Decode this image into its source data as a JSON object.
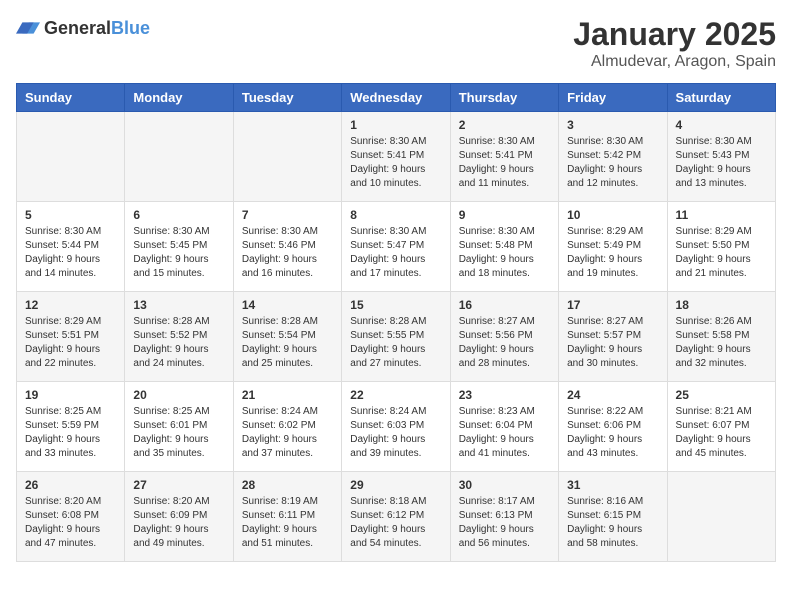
{
  "header": {
    "logo_general": "General",
    "logo_blue": "Blue",
    "month": "January 2025",
    "location": "Almudevar, Aragon, Spain"
  },
  "weekdays": [
    "Sunday",
    "Monday",
    "Tuesday",
    "Wednesday",
    "Thursday",
    "Friday",
    "Saturday"
  ],
  "weeks": [
    [
      {
        "day": "",
        "info": ""
      },
      {
        "day": "",
        "info": ""
      },
      {
        "day": "",
        "info": ""
      },
      {
        "day": "1",
        "info": "Sunrise: 8:30 AM\nSunset: 5:41 PM\nDaylight: 9 hours\nand 10 minutes."
      },
      {
        "day": "2",
        "info": "Sunrise: 8:30 AM\nSunset: 5:41 PM\nDaylight: 9 hours\nand 11 minutes."
      },
      {
        "day": "3",
        "info": "Sunrise: 8:30 AM\nSunset: 5:42 PM\nDaylight: 9 hours\nand 12 minutes."
      },
      {
        "day": "4",
        "info": "Sunrise: 8:30 AM\nSunset: 5:43 PM\nDaylight: 9 hours\nand 13 minutes."
      }
    ],
    [
      {
        "day": "5",
        "info": "Sunrise: 8:30 AM\nSunset: 5:44 PM\nDaylight: 9 hours\nand 14 minutes."
      },
      {
        "day": "6",
        "info": "Sunrise: 8:30 AM\nSunset: 5:45 PM\nDaylight: 9 hours\nand 15 minutes."
      },
      {
        "day": "7",
        "info": "Sunrise: 8:30 AM\nSunset: 5:46 PM\nDaylight: 9 hours\nand 16 minutes."
      },
      {
        "day": "8",
        "info": "Sunrise: 8:30 AM\nSunset: 5:47 PM\nDaylight: 9 hours\nand 17 minutes."
      },
      {
        "day": "9",
        "info": "Sunrise: 8:30 AM\nSunset: 5:48 PM\nDaylight: 9 hours\nand 18 minutes."
      },
      {
        "day": "10",
        "info": "Sunrise: 8:29 AM\nSunset: 5:49 PM\nDaylight: 9 hours\nand 19 minutes."
      },
      {
        "day": "11",
        "info": "Sunrise: 8:29 AM\nSunset: 5:50 PM\nDaylight: 9 hours\nand 21 minutes."
      }
    ],
    [
      {
        "day": "12",
        "info": "Sunrise: 8:29 AM\nSunset: 5:51 PM\nDaylight: 9 hours\nand 22 minutes."
      },
      {
        "day": "13",
        "info": "Sunrise: 8:28 AM\nSunset: 5:52 PM\nDaylight: 9 hours\nand 24 minutes."
      },
      {
        "day": "14",
        "info": "Sunrise: 8:28 AM\nSunset: 5:54 PM\nDaylight: 9 hours\nand 25 minutes."
      },
      {
        "day": "15",
        "info": "Sunrise: 8:28 AM\nSunset: 5:55 PM\nDaylight: 9 hours\nand 27 minutes."
      },
      {
        "day": "16",
        "info": "Sunrise: 8:27 AM\nSunset: 5:56 PM\nDaylight: 9 hours\nand 28 minutes."
      },
      {
        "day": "17",
        "info": "Sunrise: 8:27 AM\nSunset: 5:57 PM\nDaylight: 9 hours\nand 30 minutes."
      },
      {
        "day": "18",
        "info": "Sunrise: 8:26 AM\nSunset: 5:58 PM\nDaylight: 9 hours\nand 32 minutes."
      }
    ],
    [
      {
        "day": "19",
        "info": "Sunrise: 8:25 AM\nSunset: 5:59 PM\nDaylight: 9 hours\nand 33 minutes."
      },
      {
        "day": "20",
        "info": "Sunrise: 8:25 AM\nSunset: 6:01 PM\nDaylight: 9 hours\nand 35 minutes."
      },
      {
        "day": "21",
        "info": "Sunrise: 8:24 AM\nSunset: 6:02 PM\nDaylight: 9 hours\nand 37 minutes."
      },
      {
        "day": "22",
        "info": "Sunrise: 8:24 AM\nSunset: 6:03 PM\nDaylight: 9 hours\nand 39 minutes."
      },
      {
        "day": "23",
        "info": "Sunrise: 8:23 AM\nSunset: 6:04 PM\nDaylight: 9 hours\nand 41 minutes."
      },
      {
        "day": "24",
        "info": "Sunrise: 8:22 AM\nSunset: 6:06 PM\nDaylight: 9 hours\nand 43 minutes."
      },
      {
        "day": "25",
        "info": "Sunrise: 8:21 AM\nSunset: 6:07 PM\nDaylight: 9 hours\nand 45 minutes."
      }
    ],
    [
      {
        "day": "26",
        "info": "Sunrise: 8:20 AM\nSunset: 6:08 PM\nDaylight: 9 hours\nand 47 minutes."
      },
      {
        "day": "27",
        "info": "Sunrise: 8:20 AM\nSunset: 6:09 PM\nDaylight: 9 hours\nand 49 minutes."
      },
      {
        "day": "28",
        "info": "Sunrise: 8:19 AM\nSunset: 6:11 PM\nDaylight: 9 hours\nand 51 minutes."
      },
      {
        "day": "29",
        "info": "Sunrise: 8:18 AM\nSunset: 6:12 PM\nDaylight: 9 hours\nand 54 minutes."
      },
      {
        "day": "30",
        "info": "Sunrise: 8:17 AM\nSunset: 6:13 PM\nDaylight: 9 hours\nand 56 minutes."
      },
      {
        "day": "31",
        "info": "Sunrise: 8:16 AM\nSunset: 6:15 PM\nDaylight: 9 hours\nand 58 minutes."
      },
      {
        "day": "",
        "info": ""
      }
    ]
  ]
}
